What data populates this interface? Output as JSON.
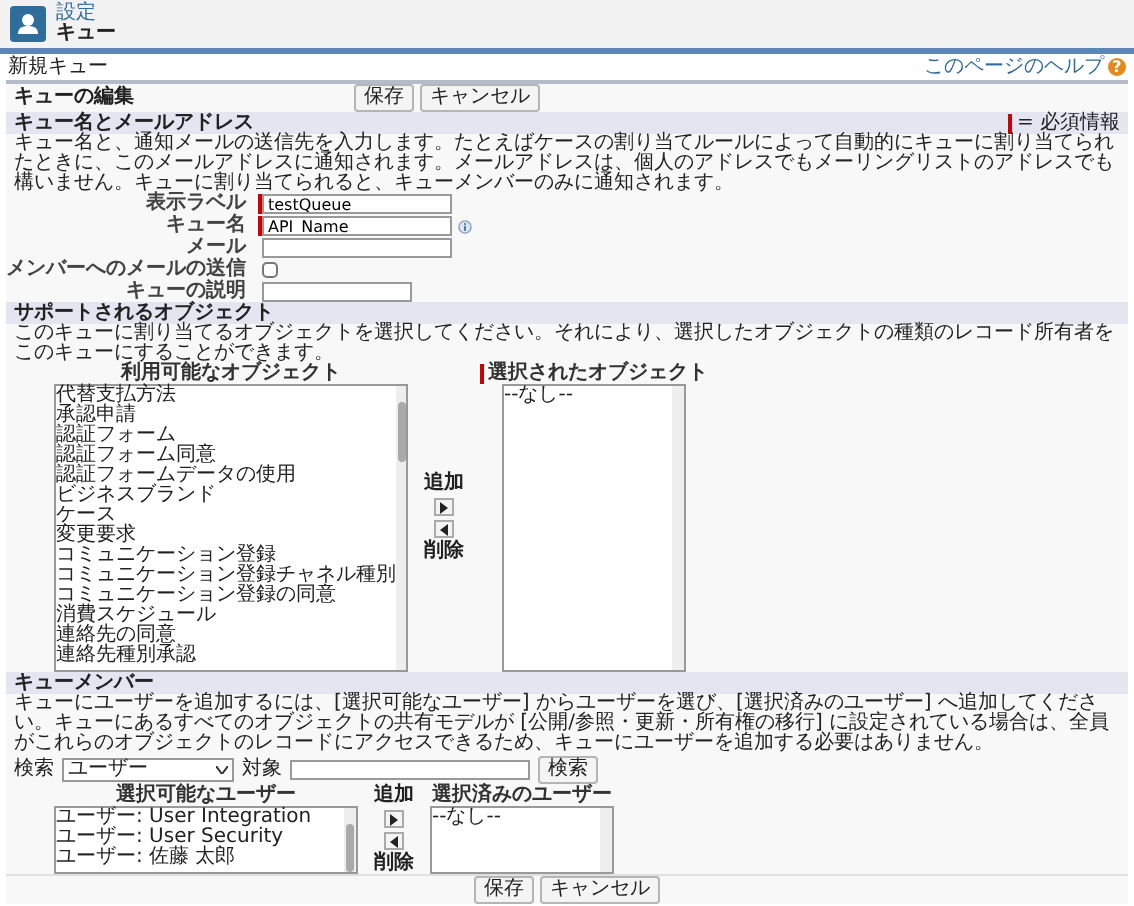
{
  "header": {
    "breadcrumb": "設定",
    "title": "キュー"
  },
  "page": {
    "title": "新規キュー",
    "help_link": "このページのヘルプ",
    "help_icon": "?"
  },
  "edit_bar": {
    "title": "キューの編集",
    "buttons": [
      "保存",
      "キャンセル"
    ]
  },
  "name_section": {
    "title": "キュー名とメールアドレス",
    "required_legend": "= 必須情報",
    "description": "キュー名と、通知メールの送信先を入力します。たとえばケースの割り当てルールによって自動的にキューに割り当てられたときに、このメールアドレスに通知されます。メールアドレスは、個人のアドレスでもメーリングリストのアドレスでも構いません。キューに割り当てられると、キューメンバーのみに通知されます。",
    "fields": [
      {
        "label": "表示ラベル",
        "kind": "text",
        "required": true,
        "help_icon": false,
        "value": "testQueue"
      },
      {
        "label": "キュー名",
        "kind": "text",
        "required": true,
        "help_icon": true,
        "value": "API_Name"
      },
      {
        "label": "メール",
        "kind": "text",
        "required": false,
        "help_icon": false
      },
      {
        "label": "メンバーへのメールの送信",
        "kind": "checkbox",
        "required": false,
        "help_icon": false,
        "checked": false
      },
      {
        "label": "キューの説明",
        "kind": "textarea",
        "required": false,
        "help_icon": false
      }
    ]
  },
  "objects_section": {
    "title": "サポートされるオブジェクト",
    "description": "このキューに割り当てるオブジェクトを選択してください。それにより、選択したオブジェクトの種類のレコード所有者をこのキューにすることができます。",
    "available": {
      "heading": "利用可能なオブジェクト",
      "required": false,
      "items": [
        "代替支払方法",
        "承認申請",
        "認証フォーム",
        "認証フォーム同意",
        "認証フォームデータの使用",
        "ビジネスブランド",
        "ケース",
        "変更要求",
        "コミュニケーション登録",
        "コミュニケーション登録チャネル種別",
        "コミュニケーション登録の同意",
        "消費スケジュール",
        "連絡先の同意",
        "連絡先種別承認"
      ]
    },
    "selected": {
      "heading": "選択されたオブジェクト",
      "required": true,
      "items": [
        "--なし--"
      ]
    },
    "add_label": "追加",
    "remove_label": "削除"
  },
  "members_section": {
    "title": "キューメンバー",
    "description": "キューにユーザーを追加するには、[選択可能なユーザー] からユーザーを選び、[選択済みのユーザー] へ追加してください。キューにあるすべてのオブジェクトの共有モデルが [公開/参照・更新・所有権の移行] に設定されている場合は、全員がこれらのオブジェクトのレコードにアクセスできるため、キューにユーザーを追加する必要はありません。",
    "search": {
      "label": "検索",
      "value": "ユーザー",
      "for_label": "対象",
      "button": "検索"
    },
    "available": {
      "heading": "選択可能なユーザー",
      "required": false,
      "items": [
        "ユーザー: User Integration",
        "ユーザー: User Security",
        "ユーザー: 佐藤 太郎"
      ]
    },
    "selected": {
      "heading": "選択済みのユーザー",
      "required": false,
      "items": [
        "--なし--"
      ]
    },
    "add_label": "追加",
    "remove_label": "削除"
  },
  "footer_buttons": [
    "保存",
    "キャンセル"
  ]
}
